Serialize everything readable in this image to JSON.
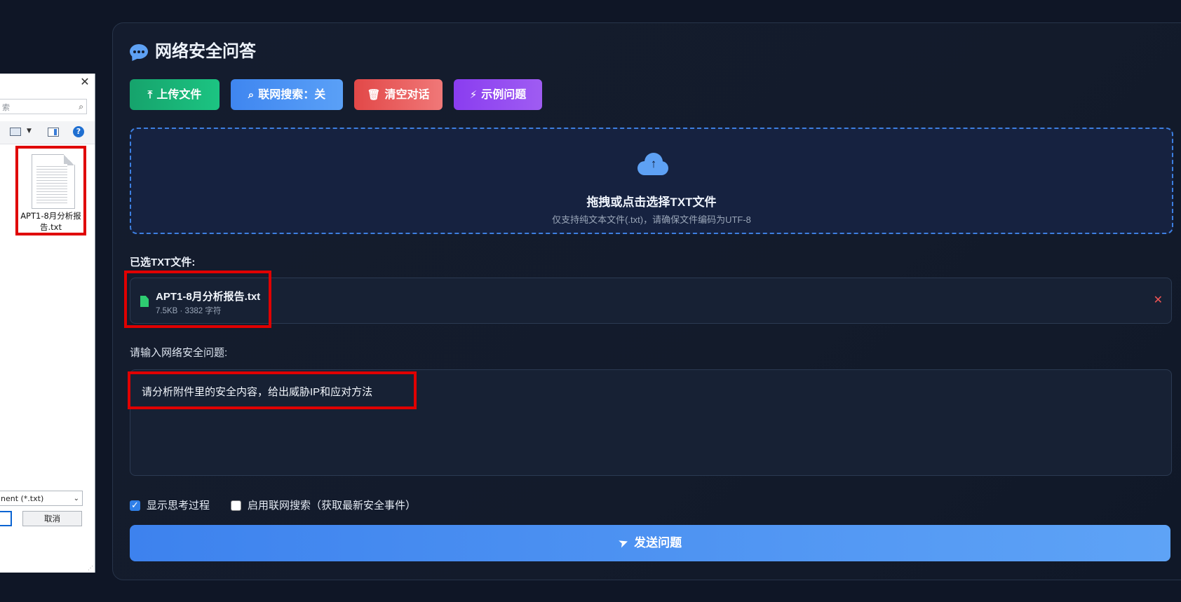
{
  "dialog": {
    "close_glyph": "✕",
    "search_placeholder": "索",
    "file_name": "APT1-8月分析报告.txt",
    "filter": "nent (*.txt)",
    "cancel_label": "取消",
    "help_glyph": "?"
  },
  "header": {
    "title": "网络安全问答",
    "icon": "comment-dots-icon"
  },
  "toolbar": {
    "upload_label": "上传文件",
    "search_toggle_label": "联网搜索：关",
    "clear_label": "清空对话",
    "example_label": "示例问题"
  },
  "dropzone": {
    "title": "拖拽或点击选择TXT文件",
    "subtitle": "仅支持纯文本文件(.txt)，请确保文件编码为UTF-8"
  },
  "selected_files": {
    "label": "已选TXT文件:",
    "items": [
      {
        "name": "APT1-8月分析报告.txt",
        "meta": "7.5KB · 3382 字符"
      }
    ]
  },
  "question": {
    "label": "请输入网络安全问题:",
    "value": "请分析附件里的安全内容，给出威胁IP和应对方法"
  },
  "options": {
    "show_thinking": {
      "label": "显示思考过程",
      "checked": true
    },
    "web_search": {
      "label": "启用联网搜索（获取最新安全事件）",
      "checked": false
    }
  },
  "send_label": "发送问题",
  "colors": {
    "background": "#0f1626",
    "upload": "#1cc482",
    "search": "#4a90f2",
    "clear": "#e85c5c",
    "example": "#9350f1",
    "send": "#4a92f2",
    "highlight": "#e00000"
  }
}
